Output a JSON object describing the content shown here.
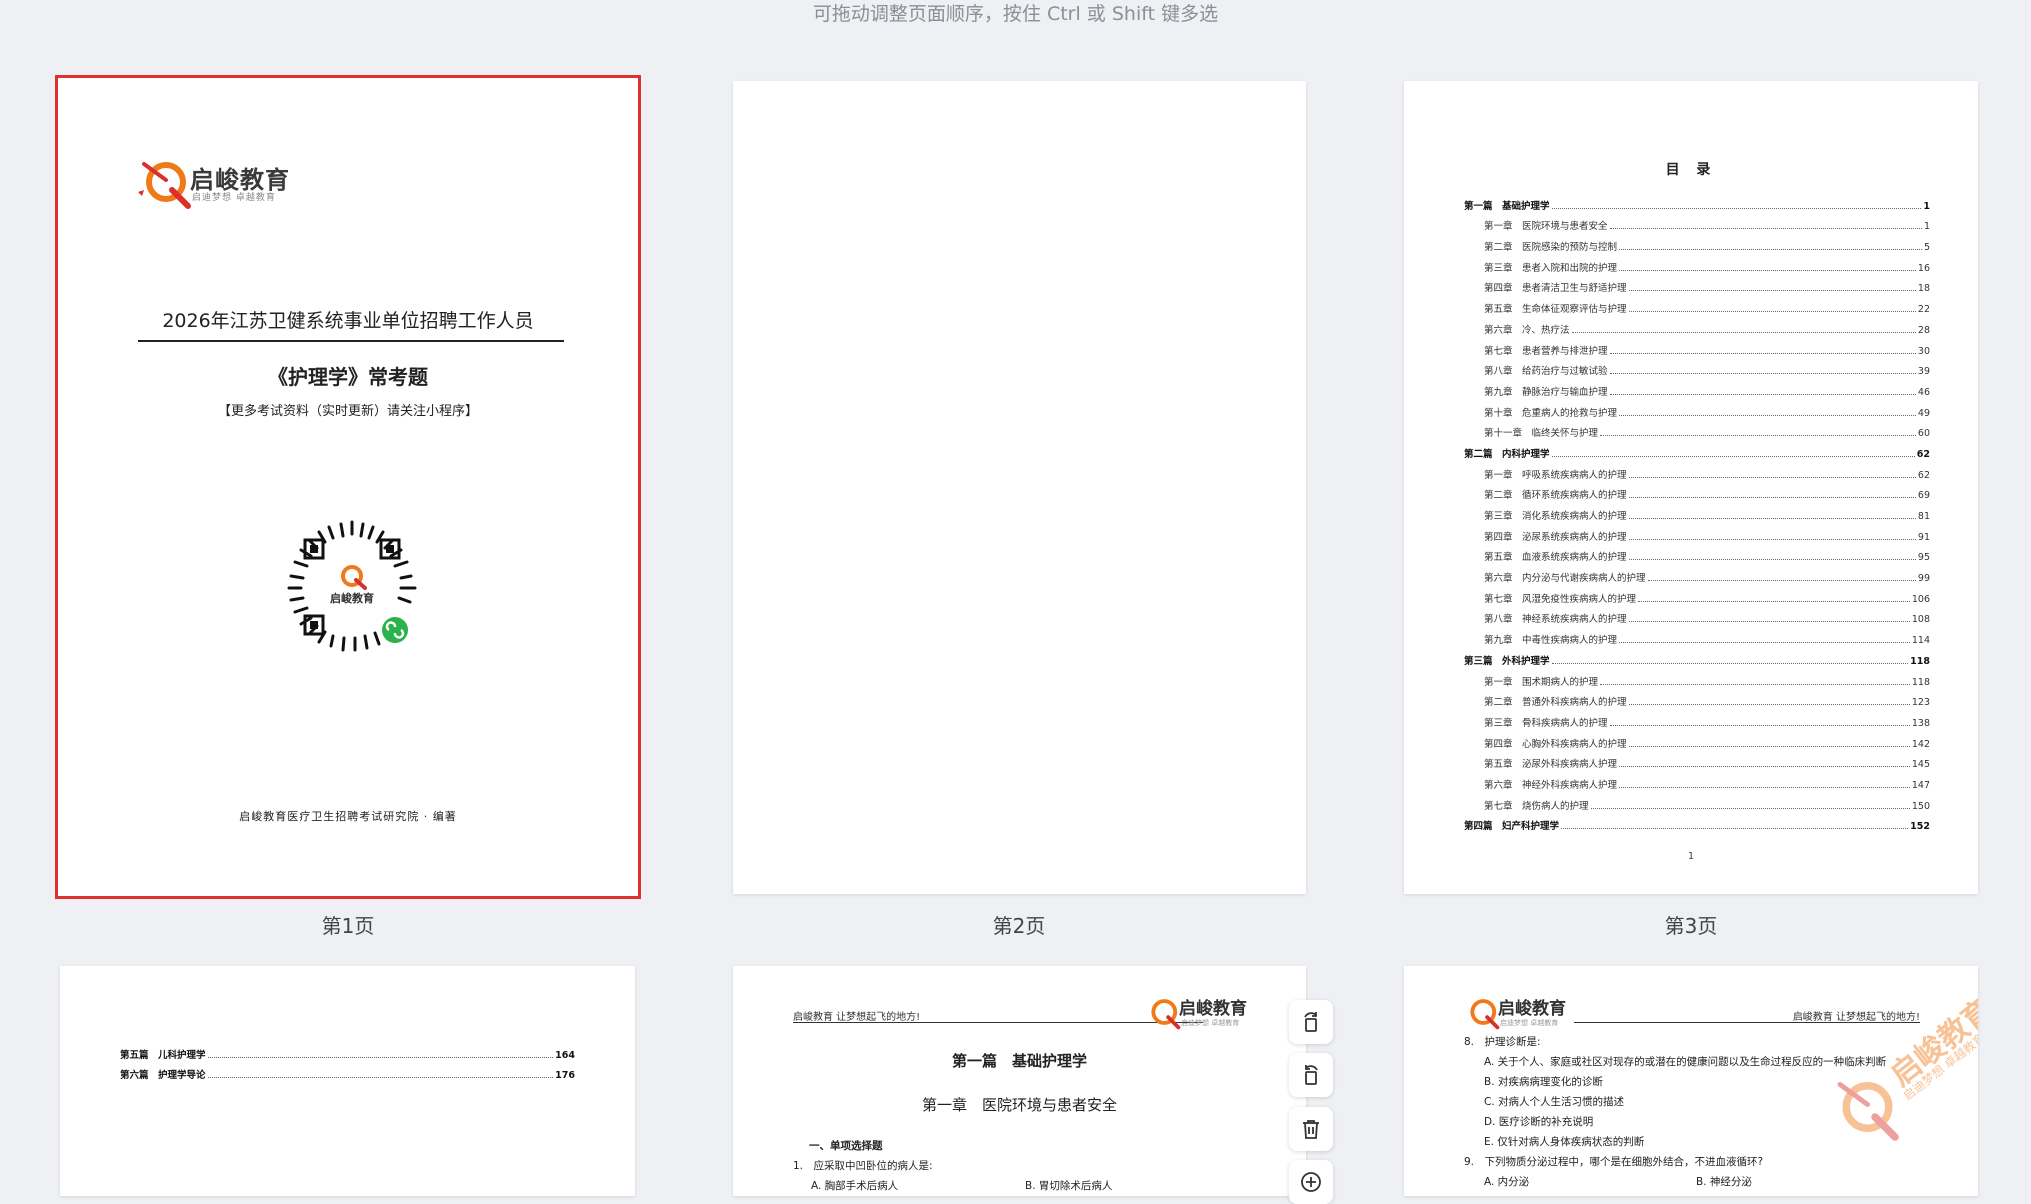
{
  "hint": "可拖动调整页面顺序，按住 Ctrl 或 Shift 键多选",
  "page_labels": [
    "第1页",
    "第2页",
    "第3页"
  ],
  "cover": {
    "logo_name": "启峻教育",
    "logo_slogan": "启迪梦想 卓越教育",
    "title": "2026年江苏卫健系统事业单位招聘工作人员",
    "subtitle": "《护理学》常考题",
    "note": "【更多考试资料（实时更新）请关注小程序】",
    "qr_center_label": "启峻教育",
    "footer": "启峻教育医疗卫生招聘考试研究院 · 编著"
  },
  "toc": {
    "title": "目 录",
    "page_number": "1",
    "rows": [
      {
        "label": "第一篇　基础护理学",
        "page": "1",
        "level": "part"
      },
      {
        "label": "第一章　医院环境与患者安全",
        "page": "1",
        "level": "chap"
      },
      {
        "label": "第二章　医院感染的预防与控制",
        "page": "5",
        "level": "chap"
      },
      {
        "label": "第三章　患者入院和出院的护理",
        "page": "16",
        "level": "chap"
      },
      {
        "label": "第四章　患者清洁卫生与舒适护理",
        "page": "18",
        "level": "chap"
      },
      {
        "label": "第五章　生命体征观察评估与护理",
        "page": "22",
        "level": "chap"
      },
      {
        "label": "第六章　冷、热疗法",
        "page": "28",
        "level": "chap"
      },
      {
        "label": "第七章　患者营养与排泄护理",
        "page": "30",
        "level": "chap"
      },
      {
        "label": "第八章　给药治疗与过敏试验",
        "page": "39",
        "level": "chap"
      },
      {
        "label": "第九章　静脉治疗与输血护理",
        "page": "46",
        "level": "chap"
      },
      {
        "label": "第十章　危重病人的抢救与护理",
        "page": "49",
        "level": "chap"
      },
      {
        "label": "第十一章　临终关怀与护理",
        "page": "60",
        "level": "chap"
      },
      {
        "label": "第二篇　内科护理学",
        "page": "62",
        "level": "part"
      },
      {
        "label": "第一章　呼吸系统疾病病人的护理",
        "page": "62",
        "level": "chap"
      },
      {
        "label": "第二章　循环系统疾病病人的护理",
        "page": "69",
        "level": "chap"
      },
      {
        "label": "第三章　消化系统疾病病人的护理",
        "page": "81",
        "level": "chap"
      },
      {
        "label": "第四章　泌尿系统疾病病人的护理",
        "page": "91",
        "level": "chap"
      },
      {
        "label": "第五章　血液系统疾病病人的护理",
        "page": "95",
        "level": "chap"
      },
      {
        "label": "第六章　内分泌与代谢疾病病人的护理",
        "page": "99",
        "level": "chap"
      },
      {
        "label": "第七章　风湿免疫性疾病病人的护理",
        "page": "106",
        "level": "chap"
      },
      {
        "label": "第八章　神经系统疾病病人的护理",
        "page": "108",
        "level": "chap"
      },
      {
        "label": "第九章　中毒性疾病病人的护理",
        "page": "114",
        "level": "chap"
      },
      {
        "label": "第三篇　外科护理学",
        "page": "118",
        "level": "part"
      },
      {
        "label": "第一章　围术期病人的护理",
        "page": "118",
        "level": "chap"
      },
      {
        "label": "第二章　普通外科疾病病人的护理",
        "page": "123",
        "level": "chap"
      },
      {
        "label": "第三章　骨科疾病病人的护理",
        "page": "138",
        "level": "chap"
      },
      {
        "label": "第四章　心胸外科疾病病人的护理",
        "page": "142",
        "level": "chap"
      },
      {
        "label": "第五章　泌尿外科疾病病人护理",
        "page": "145",
        "level": "chap"
      },
      {
        "label": "第六章　神经外科疾病病人护理",
        "page": "147",
        "level": "chap"
      },
      {
        "label": "第七章　烧伤病人的护理",
        "page": "150",
        "level": "chap"
      },
      {
        "label": "第四篇　妇产科护理学",
        "page": "152",
        "level": "part"
      }
    ]
  },
  "toc_cont": [
    {
      "label": "第五篇　儿科护理学",
      "page": "164"
    },
    {
      "label": "第六篇　护理学导论",
      "page": "176"
    }
  ],
  "page5": {
    "header_left": "启峻教育  让梦想起飞的地方!",
    "logo_name": "启峻教育",
    "logo_slogan": "启迪梦想 卓越教育",
    "part_title": "第一篇　基础护理学",
    "chapter_title": "第一章　医院环境与患者安全",
    "section": "一、单项选择题",
    "q1": "1.　应采取中凹卧位的病人是:",
    "q1_a": "A. 胸部手术后病人",
    "q1_b": "B. 胃切除术后病人"
  },
  "page6": {
    "header_right": "启峻教育  让梦想起飞的地方!",
    "logo_name": "启峻教育",
    "logo_slogan": "启迪梦想 卓越教育",
    "lines": [
      "8.　护理诊断是:",
      "A. 关于个人、家庭或社区对现存的或潜在的健康问题以及生命过程反应的一种临床判断",
      "B. 对疾病病理变化的诊断",
      "C. 对病人个人生活习惯的描述",
      "D. 医疗诊断的补充说明",
      "E. 仅针对病人身体疾病状态的判断",
      "9.　下列物质分泌过程中，哪个是在细胞外结合，不进血液循环?",
      "A. 内分泌"
    ],
    "q9_b": "B. 神经分泌",
    "watermark_name": "启峻教育",
    "watermark_slogan": "启迪梦想 卓越教育"
  },
  "icons": [
    "rotate-left-icon",
    "rotate-right-icon",
    "delete-icon",
    "zoom-in-icon"
  ],
  "colors": {
    "accent_red": "#e03131",
    "brand_orange": "#f07a1a",
    "brand_red": "#d9302a",
    "wechat_green": "#2bb24c"
  }
}
